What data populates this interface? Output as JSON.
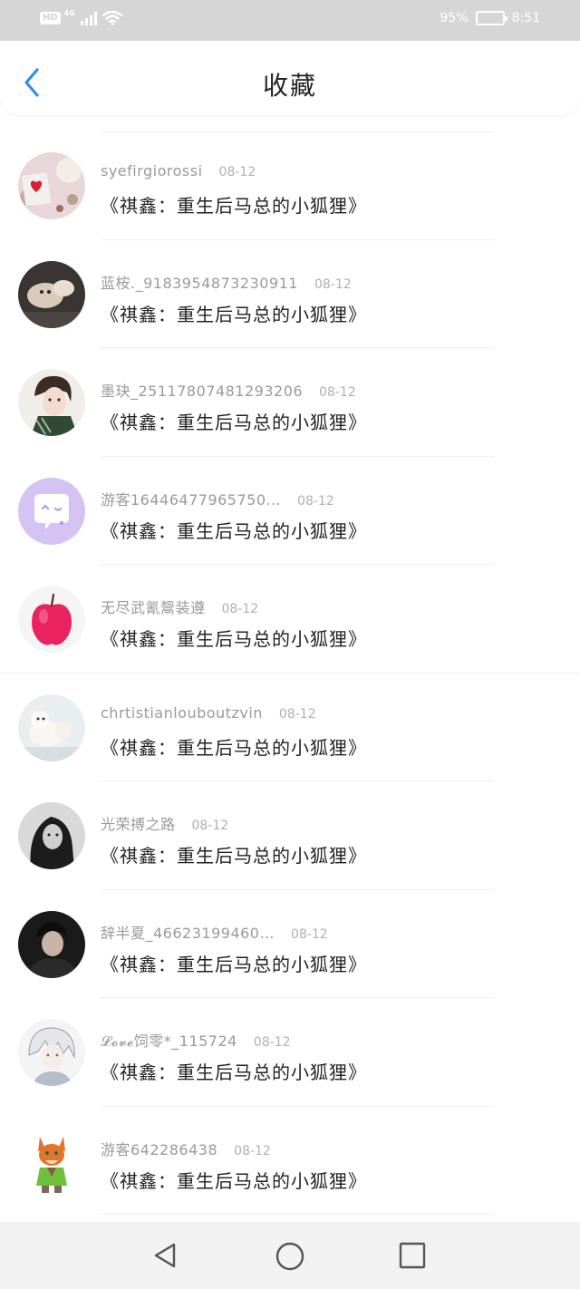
{
  "status_bar": {
    "hd": "HD",
    "network": "4G",
    "battery_percent": "95%",
    "battery_level": 0.95,
    "time": "8:51"
  },
  "header": {
    "title": "收藏",
    "back_icon": "chevron-left-icon"
  },
  "items": [
    {
      "username": "syefirgiorossi",
      "date": "08-12",
      "title": "《祺鑫：重生后马总的小狐狸》"
    },
    {
      "username": "蓝桉._9183954873230911",
      "date": "08-12",
      "title": "《祺鑫：重生后马总的小狐狸》"
    },
    {
      "username": "墨玦_25117807481293206",
      "date": "08-12",
      "title": "《祺鑫：重生后马总的小狐狸》"
    },
    {
      "username": "游客16446477965750…",
      "date": "08-12",
      "title": "《祺鑫：重生后马总的小狐狸》"
    },
    {
      "username": "无尽武氰鬶装遵",
      "date": "08-12",
      "title": "《祺鑫：重生后马总的小狐狸》"
    },
    {
      "username": "chrtistianlouboutzvin",
      "date": "08-12",
      "title": "《祺鑫：重生后马总的小狐狸》"
    },
    {
      "username": "光荣搏之路",
      "date": "08-12",
      "title": "《祺鑫：重生后马总的小狐狸》"
    },
    {
      "username": "辞半夏_46623199460…",
      "date": "08-12",
      "title": "《祺鑫：重生后马总的小狐狸》"
    },
    {
      "username": "𝓛𝓸𝓿𝓮饲零*_115724",
      "date": "08-12",
      "title": "《祺鑫：重生后马总的小狐狸》"
    },
    {
      "username": "游客642286438",
      "date": "08-12",
      "title": "《祺鑫：重生后马总的小狐狸》"
    }
  ],
  "nav_bar": {
    "back": "triangle-back-icon",
    "home": "circle-home-icon",
    "recent": "square-recent-icon"
  },
  "colors": {
    "accent": "#2f8fe8",
    "status_bar_bg": "#d6d6d6",
    "nav_bar_bg": "#f2f2f2"
  }
}
